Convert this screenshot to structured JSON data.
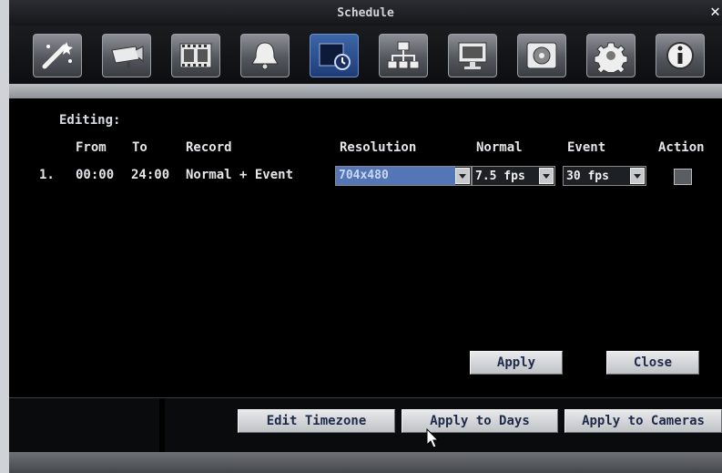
{
  "window": {
    "title": "Schedule",
    "close_glyph": "✕"
  },
  "toolbar": {
    "icons": [
      {
        "name": "wizard-icon"
      },
      {
        "name": "camera-icon"
      },
      {
        "name": "film-icon"
      },
      {
        "name": "alarm-bell-icon"
      },
      {
        "name": "schedule-icon",
        "active": true
      },
      {
        "name": "network-icon"
      },
      {
        "name": "monitor-icon"
      },
      {
        "name": "disk-icon"
      },
      {
        "name": "gear-icon"
      },
      {
        "name": "info-icon"
      }
    ]
  },
  "editor": {
    "heading": "Editing:",
    "columns": {
      "from": "From",
      "to": "To",
      "record": "Record",
      "resolution": "Resolution",
      "normal": "Normal",
      "event": "Event",
      "action": "Action"
    },
    "rows": [
      {
        "index": "1.",
        "from": "00:00",
        "to": "24:00",
        "record": "Normal + Event",
        "resolution": "704x480",
        "normal": "7.5 fps",
        "event": "30 fps",
        "action_checked": false
      }
    ],
    "apply_label": "Apply",
    "close_label": "Close"
  },
  "bottom": {
    "edit_timezone_label": "Edit Timezone",
    "apply_days_label": "Apply to Days",
    "apply_cameras_label": "Apply to Cameras"
  },
  "colors": {
    "accent_selected": "#5476b6",
    "active_tab": "#2a4f93"
  }
}
